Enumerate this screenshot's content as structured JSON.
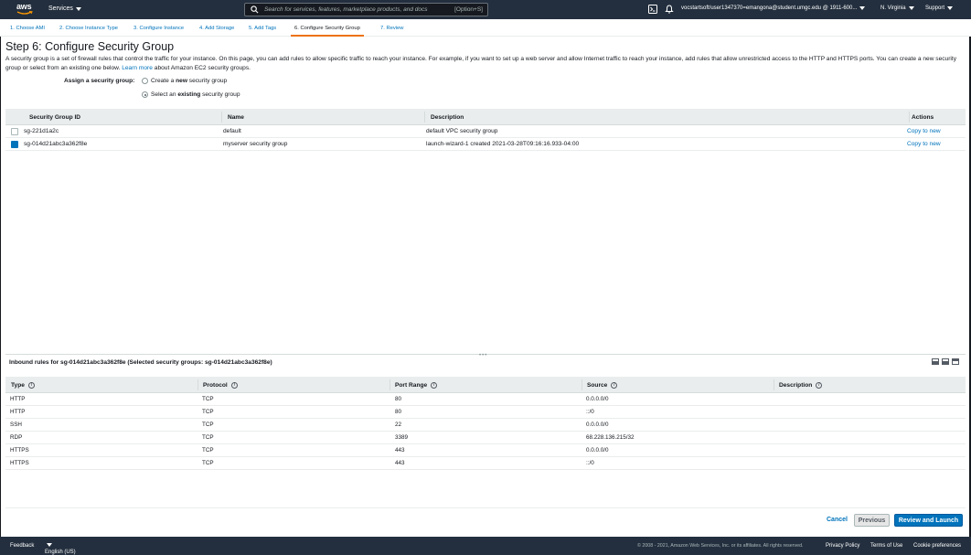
{
  "topnav": {
    "logo_text": "aws",
    "services_label": "Services",
    "search_placeholder": "Search for services, features, marketplace products, and docs",
    "search_shortcut": "[Option+S]",
    "account": "vocstartsoft/user1347370=emangona@student.umgc.edu @ 1911-600...",
    "region": "N. Virginia",
    "support": "Support",
    "icons": [
      "terminal-icon",
      "bell-icon"
    ]
  },
  "steps": [
    {
      "label": "1. Choose AMI"
    },
    {
      "label": "2. Choose Instance Type"
    },
    {
      "label": "3. Configure Instance"
    },
    {
      "label": "4. Add Storage"
    },
    {
      "label": "5. Add Tags"
    },
    {
      "label": "6. Configure Security Group"
    },
    {
      "label": "7. Review"
    }
  ],
  "page": {
    "title": "Step 6: Configure Security Group",
    "intro_text": "A security group is a set of firewall rules that control the traffic for your instance. On this page, you can add rules to allow specific traffic to reach your instance. For example, if you want to set up a web server and allow Internet traffic to reach your instance, add rules that allow unrestricted access to the HTTP and HTTPS ports. You can create a new security group or select from an existing one below.",
    "learn_more": "Learn more",
    "intro_suffix": "about Amazon EC2 security groups.",
    "assign_label": "Assign a security group:",
    "radio_new_pre": "Create a ",
    "radio_new_bold": "new",
    "radio_new_post": " security group",
    "radio_existing_pre": "Select an ",
    "radio_existing_bold": "existing",
    "radio_existing_post": " security group",
    "selected_radio": "existing"
  },
  "sg_table": {
    "headers": {
      "id": "Security Group ID",
      "name": "Name",
      "description": "Description",
      "actions": "Actions"
    },
    "rows": [
      {
        "id": "sg-221d1a2c",
        "name": "default",
        "description": "default VPC security group",
        "action": "Copy to new",
        "checked": false
      },
      {
        "id": "sg-014d21abc3a362f8e",
        "name": "myserver security group",
        "description": "launch-wizard-1 created 2021-03-28T09:16:16.933-04:00",
        "action": "Copy to new",
        "checked": true
      }
    ]
  },
  "inbound": {
    "title": "Inbound rules for sg-014d21abc3a362f8e (Selected security groups: sg-014d21abc3a362f8e)",
    "headers": {
      "type": "Type",
      "protocol": "Protocol",
      "port": "Port Range",
      "source": "Source",
      "description": "Description"
    },
    "rows": [
      {
        "type": "HTTP",
        "protocol": "TCP",
        "port": "80",
        "source": "0.0.0.0/0"
      },
      {
        "type": "HTTP",
        "protocol": "TCP",
        "port": "80",
        "source": "::/0"
      },
      {
        "type": "SSH",
        "protocol": "TCP",
        "port": "22",
        "source": "0.0.0.0/0"
      },
      {
        "type": "RDP",
        "protocol": "TCP",
        "port": "3389",
        "source": "68.228.136.215/32"
      },
      {
        "type": "HTTPS",
        "protocol": "TCP",
        "port": "443",
        "source": "0.0.0.0/0"
      },
      {
        "type": "HTTPS",
        "protocol": "TCP",
        "port": "443",
        "source": "::/0"
      }
    ]
  },
  "buttons": {
    "cancel": "Cancel",
    "previous": "Previous",
    "launch": "Review and Launch"
  },
  "footer": {
    "feedback": "Feedback",
    "language": "English (US)",
    "copyright": "© 2008 - 2021, Amazon Web Services, Inc. or its affiliates. All rights reserved.",
    "privacy": "Privacy Policy",
    "terms": "Terms of Use",
    "cookies": "Cookie preferences"
  },
  "colors": {
    "nav": "#232f3e",
    "link": "#0073bb",
    "accent": "#ec7211",
    "primary": "#0073bb"
  }
}
